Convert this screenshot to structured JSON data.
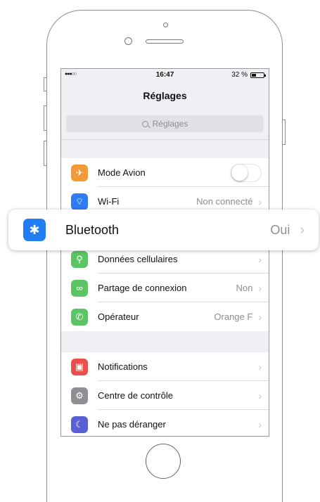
{
  "status_bar": {
    "signal": "●●●○○",
    "time": "16:47",
    "battery": "32 %"
  },
  "nav": {
    "title": "Réglages"
  },
  "search": {
    "placeholder": "Réglages"
  },
  "group1": [
    {
      "label": "Mode Avion",
      "icon": "airplane-icon",
      "color": "#f19a37",
      "glyph": "✈",
      "toggle": false
    },
    {
      "label": "Wi-Fi",
      "icon": "wifi-icon",
      "color": "#2f7cf6",
      "glyph": "⌔",
      "value": "Non connecté"
    },
    {
      "label": "Bluetooth",
      "icon": "bluetooth-icon",
      "color": "#1f7df5",
      "glyph": "✱",
      "value": "Oui"
    },
    {
      "label": "Données cellulaires",
      "icon": "cellular-icon",
      "color": "#5cc563",
      "glyph": "⚲"
    },
    {
      "label": "Partage de connexion",
      "icon": "hotspot-icon",
      "color": "#5cc563",
      "glyph": "∞",
      "value": "Non"
    },
    {
      "label": "Opérateur",
      "icon": "phone-icon",
      "color": "#5cc563",
      "glyph": "✆",
      "value": "Orange F"
    }
  ],
  "group2": [
    {
      "label": "Notifications",
      "icon": "notifications-icon",
      "color": "#e9504c",
      "glyph": "▣"
    },
    {
      "label": "Centre de contrôle",
      "icon": "control-center-icon",
      "color": "#8e8e93",
      "glyph": "⚙"
    },
    {
      "label": "Ne pas déranger",
      "icon": "moon-icon",
      "color": "#5b5fd6",
      "glyph": "☾"
    }
  ],
  "popout": {
    "label": "Bluetooth",
    "value": "Oui",
    "icon_glyph": "✱",
    "chevron": "›"
  },
  "chevron": "›"
}
